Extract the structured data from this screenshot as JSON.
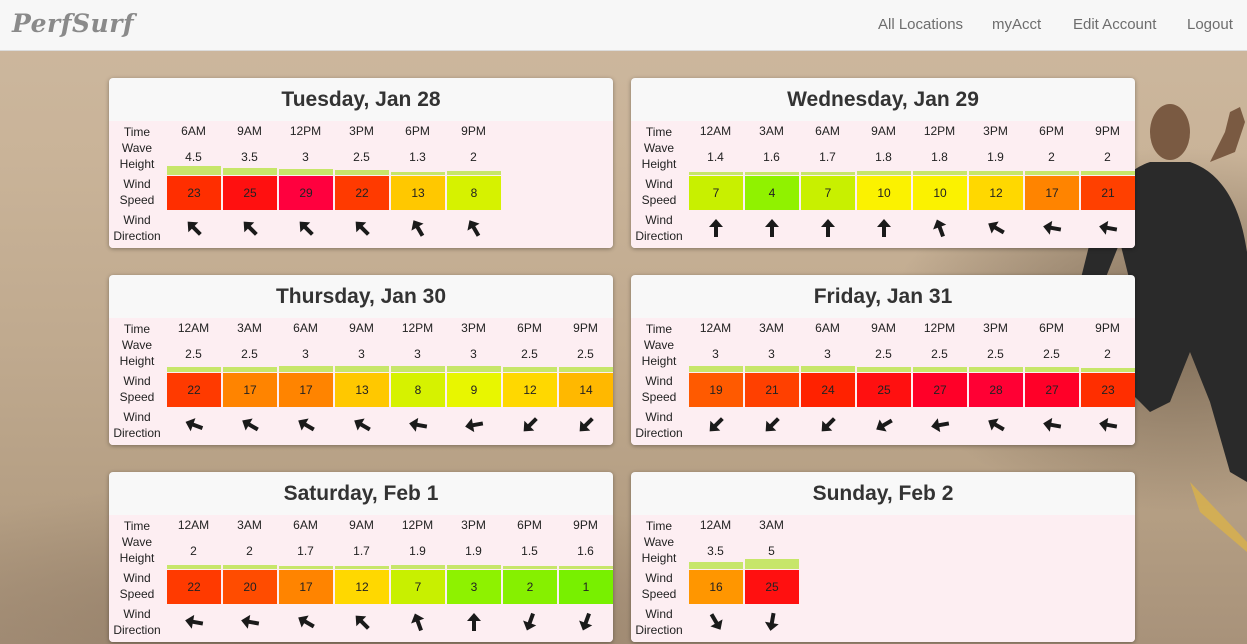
{
  "nav": {
    "brand": "PerfSurf",
    "links": [
      "All Locations",
      "myAcct",
      "Edit Account",
      "Logout"
    ]
  },
  "row_labels": {
    "time": "Time",
    "wave_1": "Wave",
    "wave_2": "Height",
    "wind_1": "Wind",
    "wind_2": "Speed",
    "dir_1": "Wind",
    "dir_2": "Direction"
  },
  "speed_colors": {
    "1": "#78f000",
    "2": "#86f000",
    "3": "#8ef200",
    "4": "#90f200",
    "7": "#c8f000",
    "8": "#d6f200",
    "9": "#e8f600",
    "10": "#fbf200",
    "12": "#ffd800",
    "13": "#ffc800",
    "14": "#ffb800",
    "16": "#ff9600",
    "17": "#ff8400",
    "19": "#ff5a00",
    "20": "#ff4c00",
    "21": "#ff4000",
    "22": "#ff3a00",
    "23": "#ff2e00",
    "24": "#ff2200",
    "25": "#ff1010",
    "27": "#ff0028",
    "28": "#ff0034",
    "29": "#ff003e"
  },
  "days": [
    {
      "title": "Tuesday, Jan 28",
      "times": [
        "6AM",
        "9AM",
        "12PM",
        "3PM",
        "6PM",
        "9PM"
      ],
      "wave_heights": [
        "4.5",
        "3.5",
        "3",
        "2.5",
        "1.3",
        "2"
      ],
      "wind_speeds": [
        "23",
        "25",
        "29",
        "22",
        "13",
        "8"
      ],
      "wind_directions_deg": [
        135,
        135,
        135,
        135,
        150,
        150
      ]
    },
    {
      "title": "Wednesday, Jan 29",
      "times": [
        "12AM",
        "3AM",
        "6AM",
        "9AM",
        "12PM",
        "3PM",
        "6PM",
        "9PM"
      ],
      "wave_heights": [
        "1.4",
        "1.6",
        "1.7",
        "1.8",
        "1.8",
        "1.9",
        "2",
        "2"
      ],
      "wind_speeds": [
        "7",
        "4",
        "7",
        "10",
        "10",
        "12",
        "17",
        "21"
      ],
      "wind_directions_deg": [
        180,
        180,
        180,
        180,
        160,
        120,
        100,
        100
      ]
    },
    {
      "title": "Thursday, Jan 30",
      "times": [
        "12AM",
        "3AM",
        "6AM",
        "9AM",
        "12PM",
        "3PM",
        "6PM",
        "9PM"
      ],
      "wave_heights": [
        "2.5",
        "2.5",
        "3",
        "3",
        "3",
        "3",
        "2.5",
        "2.5"
      ],
      "wind_speeds": [
        "22",
        "17",
        "17",
        "13",
        "8",
        "9",
        "12",
        "14"
      ],
      "wind_directions_deg": [
        110,
        120,
        120,
        120,
        100,
        80,
        45,
        45
      ]
    },
    {
      "title": "Friday, Jan 31",
      "times": [
        "12AM",
        "3AM",
        "6AM",
        "9AM",
        "12PM",
        "3PM",
        "6PM",
        "9PM"
      ],
      "wave_heights": [
        "3",
        "3",
        "3",
        "2.5",
        "2.5",
        "2.5",
        "2.5",
        "2"
      ],
      "wind_speeds": [
        "19",
        "21",
        "24",
        "25",
        "27",
        "28",
        "27",
        "23"
      ],
      "wind_directions_deg": [
        45,
        45,
        45,
        60,
        80,
        120,
        100,
        100
      ]
    },
    {
      "title": "Saturday, Feb 1",
      "times": [
        "12AM",
        "3AM",
        "6AM",
        "9AM",
        "12PM",
        "3PM",
        "6PM",
        "9PM"
      ],
      "wave_heights": [
        "2",
        "2",
        "1.7",
        "1.7",
        "1.9",
        "1.9",
        "1.5",
        "1.6"
      ],
      "wind_speeds": [
        "22",
        "20",
        "17",
        "12",
        "7",
        "3",
        "2",
        "1"
      ],
      "wind_directions_deg": [
        100,
        100,
        120,
        135,
        160,
        180,
        20,
        20
      ]
    },
    {
      "title": "Sunday, Feb 2",
      "times": [
        "12AM",
        "3AM"
      ],
      "wave_heights": [
        "3.5",
        "5"
      ],
      "wind_speeds": [
        "16",
        "25"
      ],
      "wind_directions_deg": [
        330,
        10
      ]
    }
  ]
}
